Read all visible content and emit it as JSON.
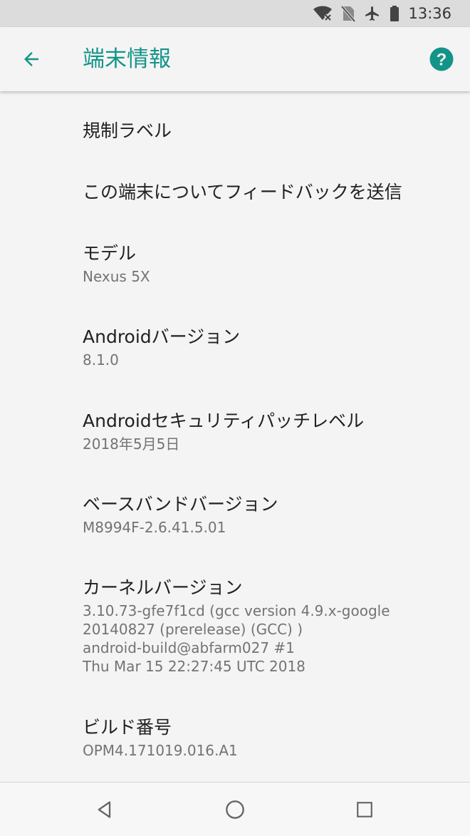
{
  "status_bar": {
    "time": "13:36",
    "icons": [
      "wifi-off-icon",
      "no-sim-icon",
      "airplane-icon",
      "battery-icon"
    ]
  },
  "app_bar": {
    "title": "端末情報",
    "back_icon": "arrow-back-icon",
    "help_icon": "help-circle-icon",
    "accent_color": "#139488"
  },
  "items": [
    {
      "title": "規制ラベル"
    },
    {
      "title": "この端末についてフィードバックを送信"
    },
    {
      "title": "モデル",
      "summary": "Nexus 5X"
    },
    {
      "title": "Androidバージョン",
      "summary": "8.1.0"
    },
    {
      "title": "Androidセキュリティパッチレベル",
      "summary": "2018年5月5日"
    },
    {
      "title": "ベースバンドバージョン",
      "summary": "M8994F-2.6.41.5.01"
    },
    {
      "title": "カーネルバージョン",
      "summary": "3.10.73-gfe7f1cd (gcc version 4.9.x-google\n20140827 (prerelease) (GCC) )\nandroid-build@abfarm027 #1\nThu Mar 15 22:27:45 UTC 2018"
    },
    {
      "title": "ビルド番号",
      "summary": "OPM4.171019.016.A1"
    }
  ],
  "nav_bar": {
    "icons": [
      "back-triangle-icon",
      "home-circle-icon",
      "recents-square-icon"
    ]
  }
}
